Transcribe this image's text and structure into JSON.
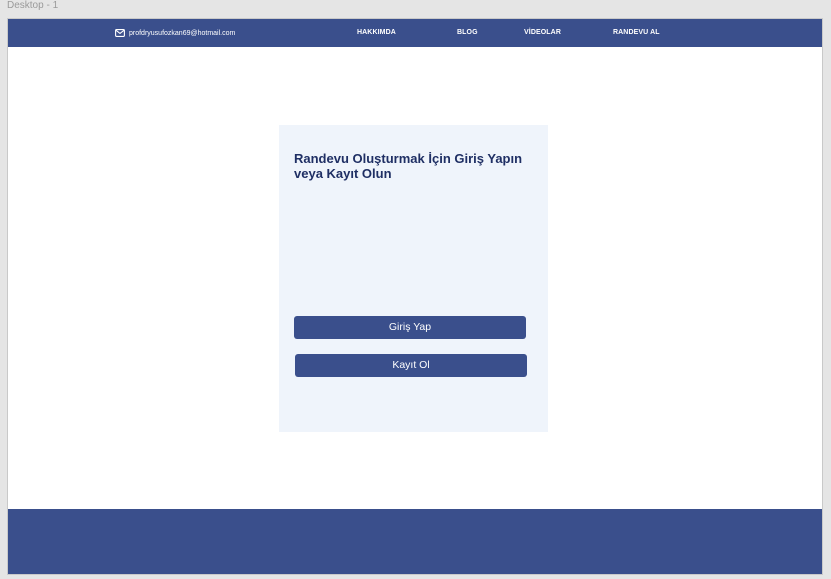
{
  "canvas": {
    "frame_label": "Desktop - 1"
  },
  "header": {
    "email": "profdryusufozkan69@hotmail.com",
    "nav": [
      {
        "label": "HAKKIMDA"
      },
      {
        "label": "BLOG"
      },
      {
        "label": "VİDEOLAR"
      },
      {
        "label": "RANDEVU AL"
      }
    ]
  },
  "card": {
    "title": "Randevu Oluşturmak İçin Giriş Yapın veya Kayıt Olun",
    "login_button": "Giriş Yap",
    "register_button": "Kayıt Ol"
  },
  "colors": {
    "brand": "#3a4f8c",
    "card_bg": "#eff4fb",
    "title_text": "#1f2f64"
  },
  "icons": {
    "email": "mail-icon"
  }
}
